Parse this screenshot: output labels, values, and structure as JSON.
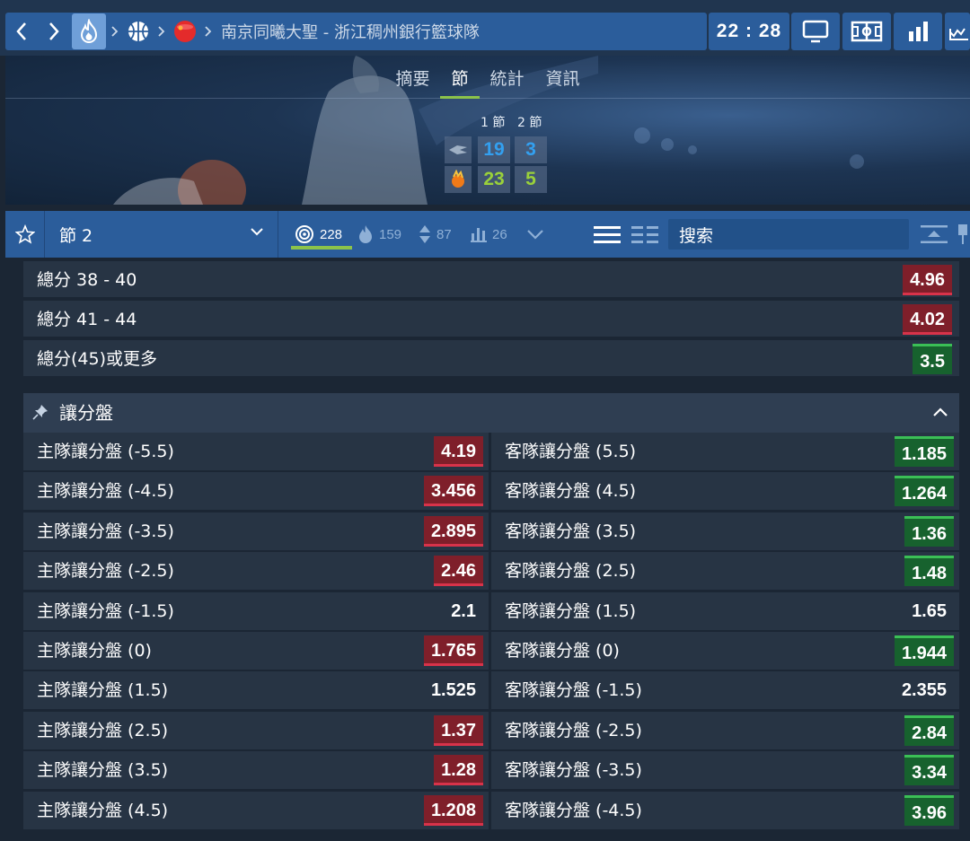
{
  "header": {
    "match_title": "南京同曦大聖 - 浙江稠州銀行籃球隊",
    "clock": "22 : 28",
    "icons": [
      "back-icon",
      "forward-icon",
      "fire-icon",
      "basketball-icon",
      "china-flag-icon",
      "tv-icon",
      "field-icon",
      "stats-icon",
      "lineup-icon"
    ]
  },
  "hero": {
    "tabs": [
      "摘要",
      "節",
      "統計",
      "資訊"
    ],
    "active_tab": "節",
    "periods": [
      "1 節",
      "2 節"
    ],
    "home_scores": [
      "19",
      "3"
    ],
    "away_scores": [
      "23",
      "5"
    ]
  },
  "market_bar": {
    "period_value": "節 2",
    "stat_all": "228",
    "stat_hot": "159",
    "stat_updown": "87",
    "stat_bars": "26",
    "search_placeholder": "搜索"
  },
  "totals": [
    {
      "label": "總分 38 - 40",
      "odds": "4.96",
      "trend": "down"
    },
    {
      "label": "總分 41 - 44",
      "odds": "4.02",
      "trend": "down"
    },
    {
      "label": "總分(45)或更多",
      "odds": "3.5",
      "trend": "up"
    }
  ],
  "handicap": {
    "title": "讓分盤",
    "rows": [
      {
        "home": "主隊讓分盤 (-5.5)",
        "home_odds": "4.19",
        "home_trend": "down",
        "away": "客隊讓分盤 (5.5)",
        "away_odds": "1.185",
        "away_trend": "up"
      },
      {
        "home": "主隊讓分盤 (-4.5)",
        "home_odds": "3.456",
        "home_trend": "down",
        "away": "客隊讓分盤 (4.5)",
        "away_odds": "1.264",
        "away_trend": "up"
      },
      {
        "home": "主隊讓分盤 (-3.5)",
        "home_odds": "2.895",
        "home_trend": "down",
        "away": "客隊讓分盤 (3.5)",
        "away_odds": "1.36",
        "away_trend": "up"
      },
      {
        "home": "主隊讓分盤 (-2.5)",
        "home_odds": "2.46",
        "home_trend": "down",
        "away": "客隊讓分盤 (2.5)",
        "away_odds": "1.48",
        "away_trend": "up"
      },
      {
        "home": "主隊讓分盤 (-1.5)",
        "home_odds": "2.1",
        "home_trend": "flat",
        "away": "客隊讓分盤 (1.5)",
        "away_odds": "1.65",
        "away_trend": "flat"
      },
      {
        "home": "主隊讓分盤 (0)",
        "home_odds": "1.765",
        "home_trend": "down",
        "away": "客隊讓分盤 (0)",
        "away_odds": "1.944",
        "away_trend": "up"
      },
      {
        "home": "主隊讓分盤 (1.5)",
        "home_odds": "1.525",
        "home_trend": "flat",
        "away": "客隊讓分盤 (-1.5)",
        "away_odds": "2.355",
        "away_trend": "flat"
      },
      {
        "home": "主隊讓分盤 (2.5)",
        "home_odds": "1.37",
        "home_trend": "down",
        "away": "客隊讓分盤 (-2.5)",
        "away_odds": "2.84",
        "away_trend": "up"
      },
      {
        "home": "主隊讓分盤 (3.5)",
        "home_odds": "1.28",
        "home_trend": "down",
        "away": "客隊讓分盤 (-3.5)",
        "away_odds": "3.34",
        "away_trend": "up"
      },
      {
        "home": "主隊讓分盤 (4.5)",
        "home_odds": "1.208",
        "home_trend": "down",
        "away": "客隊讓分盤 (-4.5)",
        "away_odds": "3.96",
        "away_trend": "up"
      }
    ]
  },
  "colors": {
    "accent_green": "#8cc34a",
    "odds_down": "#7f1f2a",
    "odds_up": "#17622e",
    "bar_blue": "#2b5d9b"
  }
}
